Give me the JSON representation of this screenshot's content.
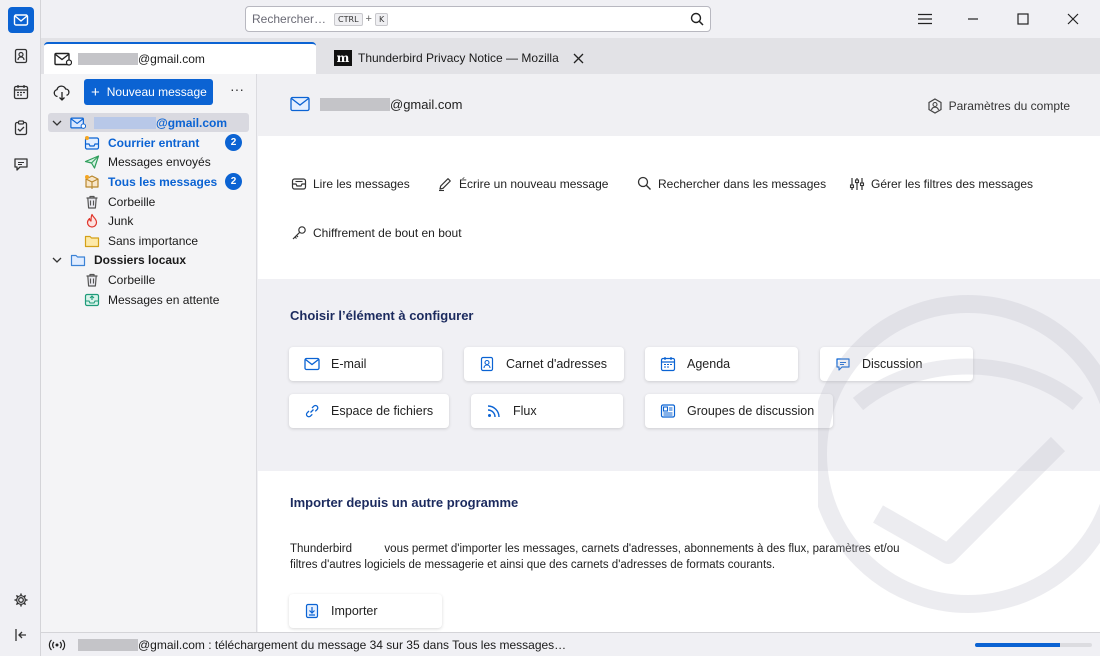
{
  "search": {
    "placeholder": "Rechercher…",
    "shortcut_mod": "CTRL",
    "shortcut_plus": "+",
    "shortcut_key": "K"
  },
  "tabs": [
    {
      "label": "@gmail.com",
      "icon": "mail-icon"
    },
    {
      "label": "Thunderbird Privacy Notice — Mozilla",
      "icon": "mozilla-m-icon"
    }
  ],
  "folder_pane": {
    "new_message": "Nouveau message",
    "more": "···",
    "account": "@gmail.com",
    "folders": [
      {
        "label": "Courrier entrant",
        "badge": "2",
        "icon": "inbox-icon"
      },
      {
        "label": "Messages envoyés",
        "icon": "sent-icon"
      },
      {
        "label": "Tous les messages",
        "badge": "2",
        "icon": "all-mail-icon"
      },
      {
        "label": "Corbeille",
        "icon": "trash-icon"
      },
      {
        "label": "Junk",
        "icon": "junk-icon"
      },
      {
        "label": "Sans importance",
        "icon": "folder-icon"
      }
    ],
    "local_folders": "Dossiers locaux",
    "local_items": [
      {
        "label": "Corbeille",
        "icon": "trash-icon"
      },
      {
        "label": "Messages en attente",
        "icon": "outbox-icon"
      }
    ]
  },
  "main": {
    "account_email": "@gmail.com",
    "account_settings": "Paramètres du compte",
    "actions": [
      {
        "label": "Lire les messages",
        "icon": "read-icon"
      },
      {
        "label": "Écrire un nouveau message",
        "icon": "pencil-icon"
      },
      {
        "label": "Rechercher dans les messages",
        "icon": "search-icon"
      },
      {
        "label": "Gérer les filtres des messages",
        "icon": "filter-icon"
      },
      {
        "label": "Chiffrement de bout en bout",
        "icon": "key-icon"
      }
    ],
    "config_title": "Choisir l’élément à configurer",
    "config_items": [
      {
        "label": "E-mail",
        "icon": "mail-icon"
      },
      {
        "label": "Carnet d'adresses",
        "icon": "address-book-icon"
      },
      {
        "label": "Agenda",
        "icon": "calendar-icon"
      },
      {
        "label": "Discussion",
        "icon": "chat-icon"
      },
      {
        "label": "Espace de fichiers",
        "icon": "link-icon"
      },
      {
        "label": "Flux",
        "icon": "rss-icon"
      },
      {
        "label": "Groupes de discussion",
        "icon": "newsgroup-icon"
      }
    ],
    "import_title": "Importer depuis un autre programme",
    "import_desc_1": "Thunderbird",
    "import_desc_2": "vous permet d'importer les messages, carnets d'adresses, abonnements à des flux, paramètres et/ou filtres d'autres logiciels de messagerie et ainsi que des carnets d'adresses de formats courants.",
    "import_button": "Importer"
  },
  "status": {
    "text": "@gmail.com : téléchargement du message 34 sur 35 dans Tous les messages…",
    "progress_fraction": 0.73
  },
  "colors": {
    "accent": "#0b63d3",
    "heading": "#1b2a5e"
  }
}
